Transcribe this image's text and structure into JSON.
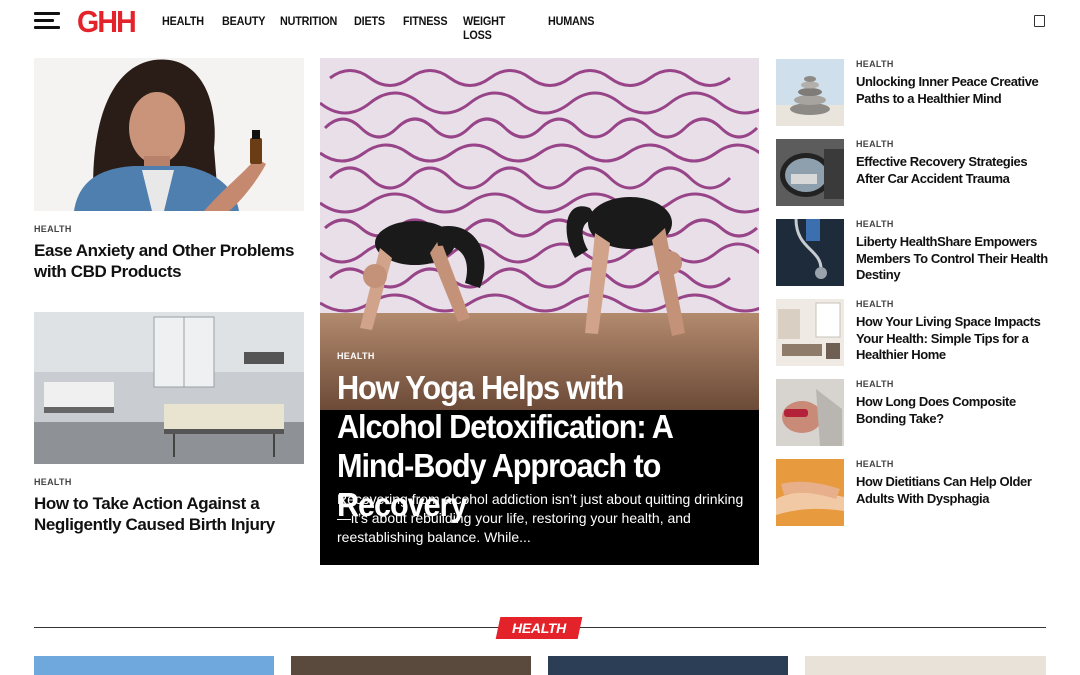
{
  "header": {
    "logo": "GHH",
    "nav": [
      "HEALTH",
      "BEAUTY",
      "NUTRITION",
      "DIETS",
      "FITNESS",
      "WEIGHT LOSS",
      "HUMANS"
    ]
  },
  "left_articles": [
    {
      "category": "HEALTH",
      "title": "Ease Anxiety and Other Problems with CBD Products"
    },
    {
      "category": "HEALTH",
      "title": "How to Take Action Against a Negligently Caused Birth Injury"
    }
  ],
  "featured": {
    "category": "HEALTH",
    "title": "How Yoga Helps with Alcohol Detoxification: A Mind-Body Approach to Recovery",
    "excerpt": "Recovering from alcohol addiction isn’t just about quitting drinking—it’s about rebuilding your life, restoring your health, and reestablishing balance. While..."
  },
  "right_articles": [
    {
      "category": "HEALTH",
      "title": "Unlocking Inner Peace Creative Paths to a Healthier Mind"
    },
    {
      "category": "HEALTH",
      "title": "Effective Recovery Strategies After Car Accident Trauma"
    },
    {
      "category": "HEALTH",
      "title": "Liberty HealthShare Empowers Members To Control Their Health Destiny"
    },
    {
      "category": "HEALTH",
      "title": "How Your Living Space Impacts Your Health: Simple Tips for a Healthier Home"
    },
    {
      "category": "HEALTH",
      "title": "How Long Does Composite Bonding Take?"
    },
    {
      "category": "HEALTH",
      "title": "How Dietitians Can Help Older Adults With Dysphagia"
    }
  ],
  "section": {
    "label": "HEALTH"
  },
  "colors": {
    "brand_red": "#e4222a",
    "text": "#111111",
    "background": "#ffffff"
  },
  "icons": {
    "menu": "hamburger-menu-icon",
    "search": "search-icon"
  }
}
